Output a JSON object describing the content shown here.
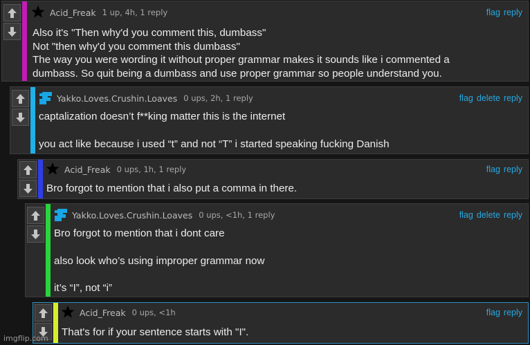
{
  "colors": {
    "accent_link": "#29a8e0",
    "bar_magenta": "#c11cb5",
    "bar_cyan": "#1fb1e8",
    "bar_blue": "#2f3ee8",
    "bar_green": "#27d63a",
    "bar_yellow": "#d7ef2a"
  },
  "icons": {
    "upvote": "arrow-up-icon",
    "downvote": "arrow-down-icon",
    "star_avatar": "star-icon",
    "blue_avatar": "blue-pixel-avatar-icon"
  },
  "comments": [
    {
      "username": "Acid_Freak",
      "meta": "1 up, 4h, 1 reply",
      "actions": {
        "flag": "flag",
        "reply": "reply"
      },
      "lines": [
        "Also it's \"Then why'd you comment this, dumbass\"",
        "Not \"then why'd you comment this dumbass\"",
        "The way you were wording it without proper grammar makes it sounds like i commented a",
        "dumbass. So quit being a dumbass and use proper grammar so people understand you."
      ]
    },
    {
      "username": "Yakko.Loves.Crushin.Loaves",
      "meta": "0 ups, 2h, 1 reply",
      "actions": {
        "flag": "flag",
        "delete": "delete",
        "reply": "reply"
      },
      "lines": [
        "captalization doesn’t f**king matter this is the internet",
        "you act like because i used “t” and not “T” i started speaking fucking Danish"
      ]
    },
    {
      "username": "Acid_Freak",
      "meta": "0 ups, 1h, 1 reply",
      "actions": {
        "flag": "flag",
        "reply": "reply"
      },
      "lines": [
        "Bro forgot to mention that i also put a comma in there."
      ]
    },
    {
      "username": "Yakko.Loves.Crushin.Loaves",
      "meta": "0 ups, <1h, 1 reply",
      "actions": {
        "flag": "flag",
        "delete": "delete",
        "reply": "reply"
      },
      "lines": [
        "Bro forgot to mention that i dont care",
        "also look who’s using improper grammar now",
        "it’s “I”, not “i”"
      ]
    },
    {
      "username": "Acid_Freak",
      "meta": "0 ups, <1h",
      "actions": {
        "flag": "flag",
        "reply": "reply"
      },
      "lines": [
        "That's for if your sentence starts with \"I\"."
      ]
    }
  ],
  "watermark": "imgflip.com"
}
